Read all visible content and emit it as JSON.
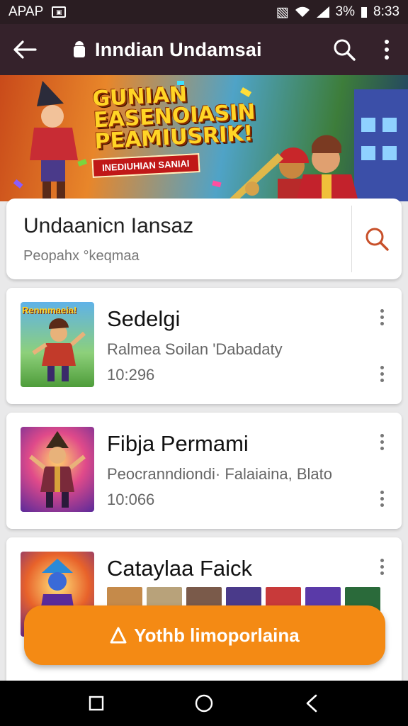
{
  "status_bar": {
    "app_label": "APAP",
    "battery_text": "3%",
    "time": "8:33"
  },
  "app_bar": {
    "title": "Inndian Undamsai"
  },
  "banner": {
    "headline": "GUNIAN EASENOIASIN PEAMIUSRIK!",
    "ribbon": "INEDIUHIAN SANIAI"
  },
  "search": {
    "title": "Undaanicn Iansaz",
    "hint": "Peopahx °keqmaa"
  },
  "items": [
    {
      "title": "Sedelgi",
      "subtitle": "Ralmea Soilan 'Dabadaty",
      "meta": "10:296",
      "thumb_label": "Renmmaeia!"
    },
    {
      "title": "Fibja Permami",
      "subtitle": "Peocranndiondi· Falaiaina, Blato",
      "meta": "10:066",
      "thumb_label": ""
    },
    {
      "title": "Cataylaa Faick",
      "subtitle": "",
      "meta": ""
    }
  ],
  "fab": {
    "label": "Yothb limoporlaina"
  },
  "colors": {
    "app_bar": "#35222b",
    "accent": "#f48a14",
    "search_icon": "#c8502a"
  }
}
